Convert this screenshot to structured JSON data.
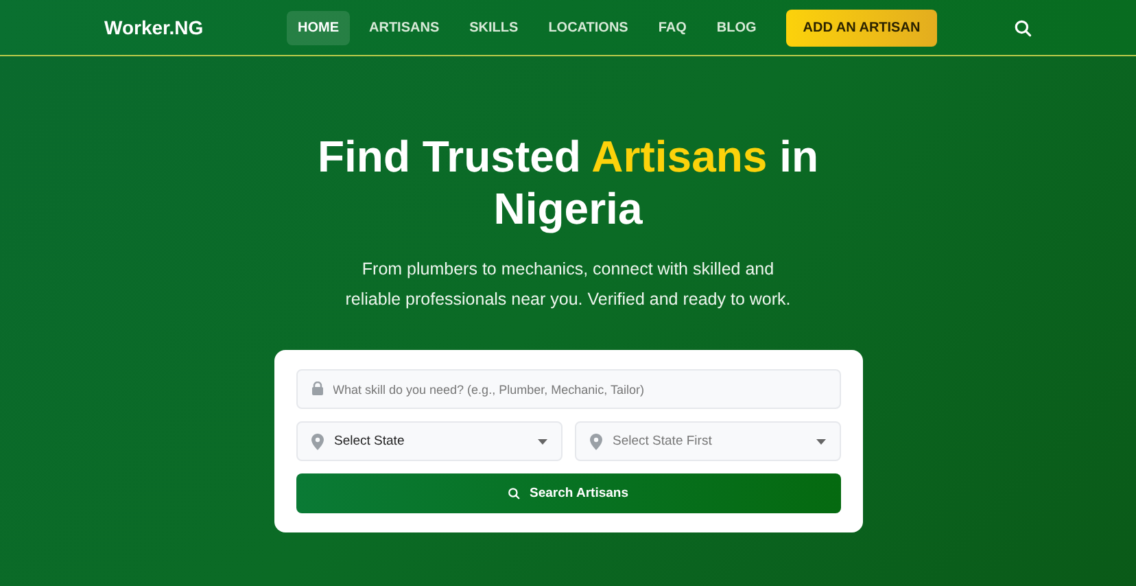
{
  "header": {
    "logo": "Worker.NG",
    "nav": [
      {
        "label": "HOME",
        "selected": true
      },
      {
        "label": "ARTISANS",
        "selected": false
      },
      {
        "label": "SKILLS",
        "selected": false
      },
      {
        "label": "LOCATIONS",
        "selected": false
      },
      {
        "label": "FAQ",
        "selected": false
      },
      {
        "label": "BLOG",
        "selected": false
      }
    ],
    "cta": "ADD AN ARTISAN"
  },
  "hero": {
    "title": [
      {
        "text": "Find Trusted ",
        "highlight": false
      },
      {
        "text": "Artisans",
        "highlight": true
      },
      {
        "text": " in Nigeria",
        "highlight": false
      }
    ],
    "subtitle": "From plumbers to mechanics, connect with skilled and reliable professionals near you. Verified and ready to work."
  },
  "search": {
    "skill": {
      "placeholder": "What skill do you need? (e.g., Plumber, Mechanic, Tailor)"
    },
    "selects": [
      {
        "value": "Select State",
        "disabled": false
      },
      {
        "value": "Select State First",
        "disabled": true
      }
    ],
    "button": "Search Artisans"
  }
}
